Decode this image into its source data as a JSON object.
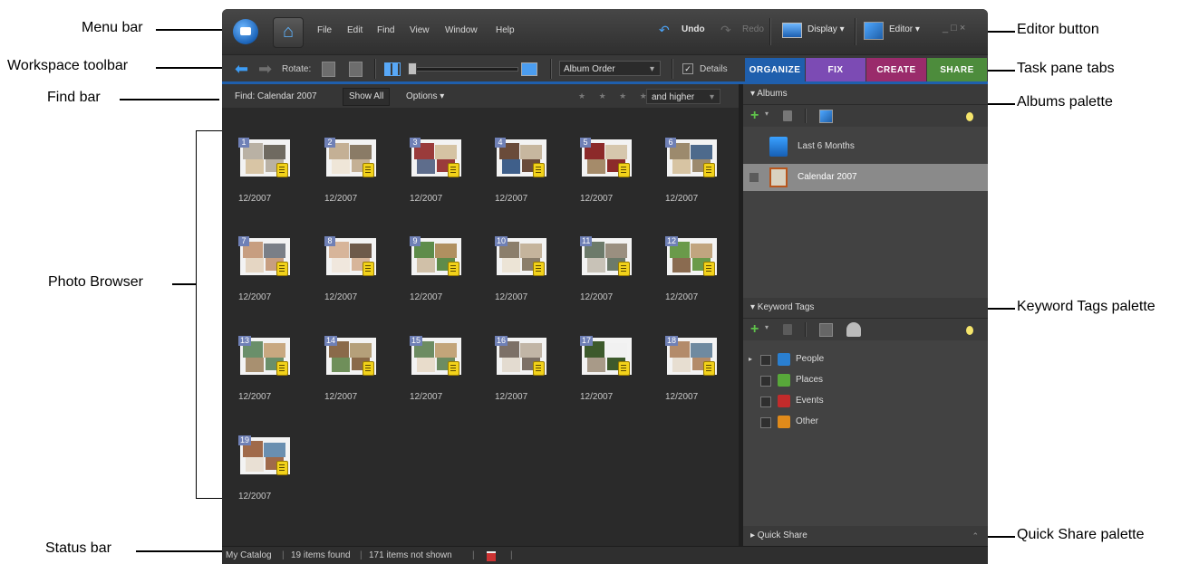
{
  "callouts": {
    "menu_bar": "Menu bar",
    "workspace_toolbar": "Workspace toolbar",
    "find_bar": "Find bar",
    "photo_browser": "Photo Browser",
    "status_bar": "Status bar",
    "editor_button": "Editor button",
    "task_pane_tabs": "Task pane tabs",
    "albums_palette": "Albums palette",
    "keyword_tags_palette": "Keyword Tags palette",
    "quick_share_palette": "Quick Share palette"
  },
  "menubar": {
    "items": [
      "File",
      "Edit",
      "Find",
      "View",
      "Window",
      "Help"
    ],
    "undo": "Undo",
    "redo": "Redo",
    "display": "Display ▾",
    "editor": "Editor ▾",
    "window_controls": "_ □ ×"
  },
  "toolbar": {
    "rotate_label": "Rotate:",
    "sort_order": "Album Order",
    "details_label": "Details",
    "details_checked": "✓"
  },
  "tabs": {
    "organize": "ORGANIZE",
    "fix": "FIX",
    "create": "CREATE",
    "share": "SHARE",
    "colors": {
      "organize": "#1f5fad",
      "fix": "#7c4bb4",
      "create": "#9a2b6b",
      "share": "#4d8c3c"
    }
  },
  "findbar": {
    "find_text": "Find: Calendar 2007",
    "show_all": "Show All",
    "options": "Options ▾",
    "stars": "★ ★ ★ ★ ★",
    "rating_filter": "and higher"
  },
  "photos": [
    {
      "number": "1",
      "date": "12/2007"
    },
    {
      "number": "2",
      "date": "12/2007"
    },
    {
      "number": "3",
      "date": "12/2007"
    },
    {
      "number": "4",
      "date": "12/2007"
    },
    {
      "number": "5",
      "date": "12/2007"
    },
    {
      "number": "6",
      "date": "12/2007"
    },
    {
      "number": "7",
      "date": "12/2007"
    },
    {
      "number": "8",
      "date": "12/2007"
    },
    {
      "number": "9",
      "date": "12/2007"
    },
    {
      "number": "10",
      "date": "12/2007"
    },
    {
      "number": "11",
      "date": "12/2007"
    },
    {
      "number": "12",
      "date": "12/2007"
    },
    {
      "number": "13",
      "date": "12/2007"
    },
    {
      "number": "14",
      "date": "12/2007"
    },
    {
      "number": "15",
      "date": "12/2007"
    },
    {
      "number": "16",
      "date": "12/2007"
    },
    {
      "number": "17",
      "date": "12/2007"
    },
    {
      "number": "18",
      "date": "12/2007"
    },
    {
      "number": "19",
      "date": "12/2007"
    }
  ],
  "albums": {
    "header": "▾ Albums",
    "items": [
      {
        "label": "Last 6 Months"
      },
      {
        "label": "Calendar 2007"
      }
    ]
  },
  "keyword_tags": {
    "header": "▾ Keyword Tags",
    "items": [
      {
        "label": "People",
        "color": "#2a7fd0"
      },
      {
        "label": "Places",
        "color": "#58a83a"
      },
      {
        "label": "Events",
        "color": "#c22b2b"
      },
      {
        "label": "Other",
        "color": "#e08a1a"
      }
    ]
  },
  "quick_share": {
    "header": "▸ Quick Share"
  },
  "statusbar": {
    "catalog": "My Catalog",
    "found": "19 items found",
    "not_shown": "171 items not shown"
  }
}
